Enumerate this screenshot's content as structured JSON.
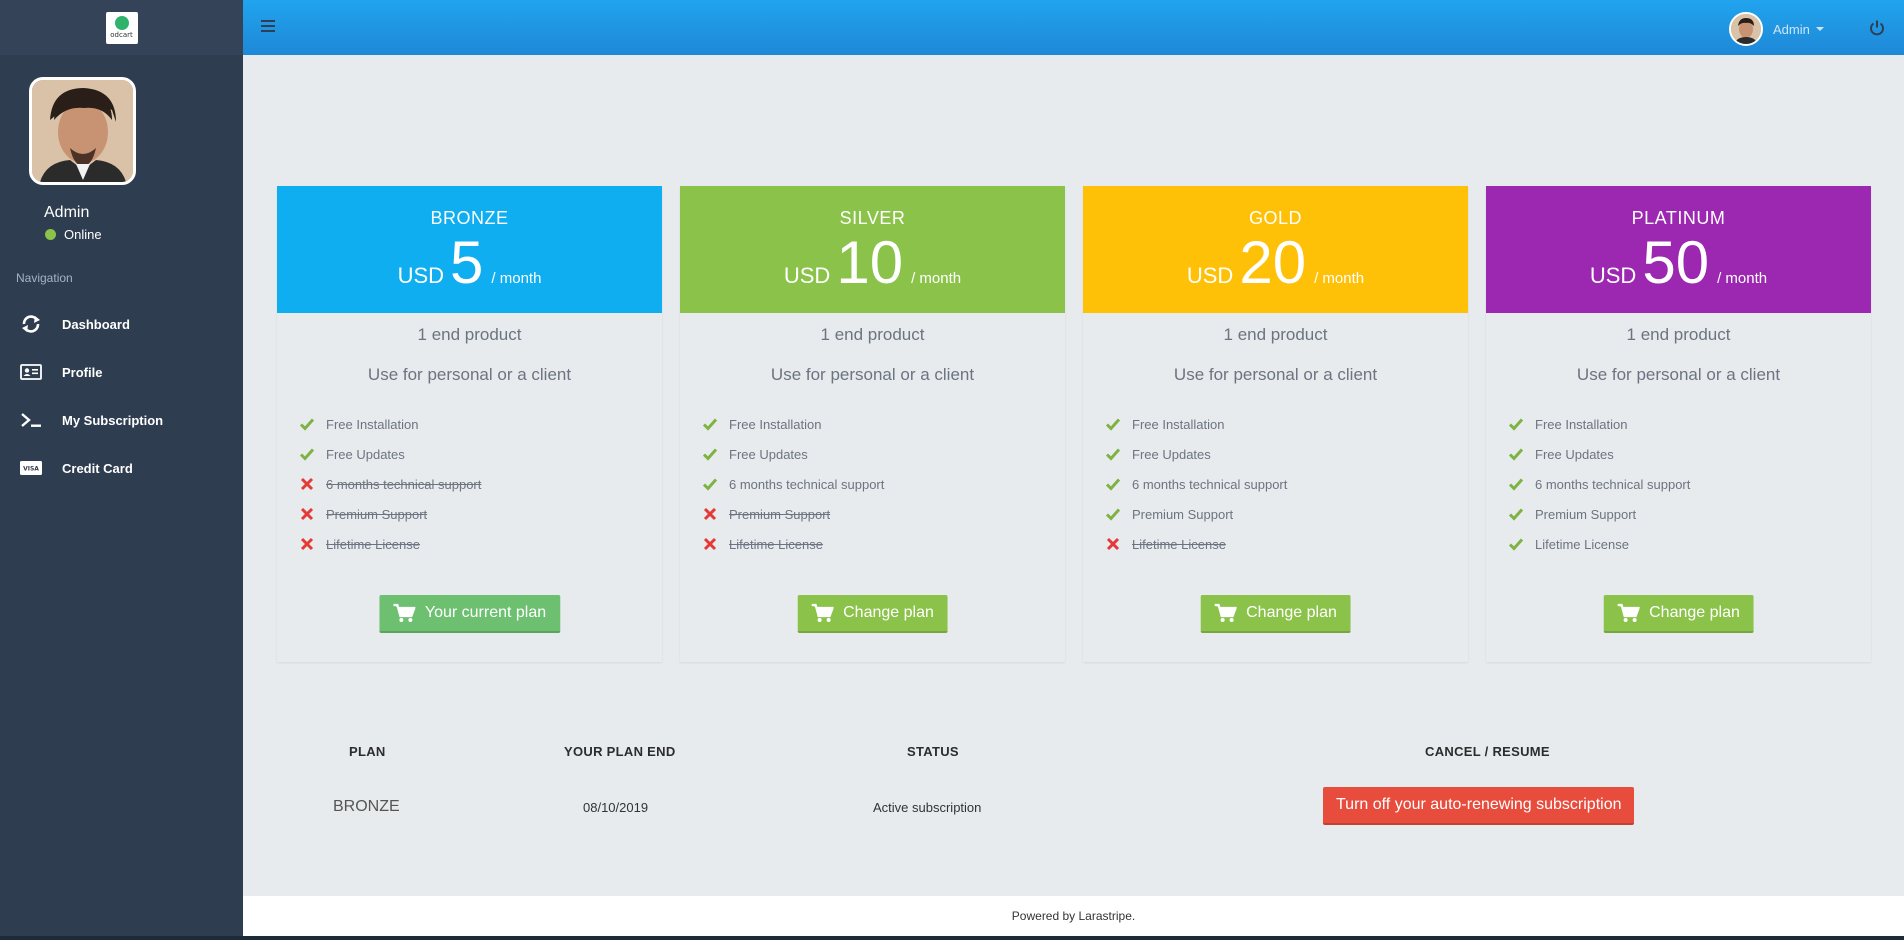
{
  "sidebar": {
    "logo_text": "odcart",
    "user_name": "Admin",
    "status": "Online",
    "nav_header": "Navigation",
    "items": [
      {
        "label": "Dashboard",
        "icon": "refresh-icon"
      },
      {
        "label": "Profile",
        "icon": "id-card-icon"
      },
      {
        "label": "My Subscription",
        "icon": "terminal-icon"
      },
      {
        "label": "Credit Card",
        "icon": "visa-card-icon"
      }
    ]
  },
  "topbar": {
    "user_name": "Admin"
  },
  "plans": [
    {
      "name": "BRONZE",
      "currency": "USD",
      "amount": "5",
      "period": "/ month",
      "color": "#0eaef0",
      "sub1": "1 end product",
      "sub2": "Use for personal or a client",
      "features": [
        {
          "text": "Free Installation",
          "included": true
        },
        {
          "text": "Free Updates",
          "included": true
        },
        {
          "text": "6 months technical support",
          "included": false
        },
        {
          "text": "Premium Support",
          "included": false
        },
        {
          "text": "Lifetime License",
          "included": false
        }
      ],
      "button": "Your current plan",
      "button_color": "#6cc070"
    },
    {
      "name": "SILVER",
      "currency": "USD",
      "amount": "10",
      "period": "/ month",
      "color": "#8bc34a",
      "sub1": "1 end product",
      "sub2": "Use for personal or a client",
      "features": [
        {
          "text": "Free Installation",
          "included": true
        },
        {
          "text": "Free Updates",
          "included": true
        },
        {
          "text": "6 months technical support",
          "included": true
        },
        {
          "text": "Premium Support",
          "included": false
        },
        {
          "text": "Lifetime License",
          "included": false
        }
      ],
      "button": "Change plan",
      "button_color": "#8bc34a"
    },
    {
      "name": "GOLD",
      "currency": "USD",
      "amount": "20",
      "period": "/ month",
      "color": "#ffc107",
      "sub1": "1 end product",
      "sub2": "Use for personal or a client",
      "features": [
        {
          "text": "Free Installation",
          "included": true
        },
        {
          "text": "Free Updates",
          "included": true
        },
        {
          "text": "6 months technical support",
          "included": true
        },
        {
          "text": "Premium Support",
          "included": true
        },
        {
          "text": "Lifetime License",
          "included": false
        }
      ],
      "button": "Change plan",
      "button_color": "#8bc34a"
    },
    {
      "name": "PLATINUM",
      "currency": "USD",
      "amount": "50",
      "period": "/ month",
      "color": "#9c27b0",
      "sub1": "1 end product",
      "sub2": "Use for personal or a client",
      "features": [
        {
          "text": "Free Installation",
          "included": true
        },
        {
          "text": "Free Updates",
          "included": true
        },
        {
          "text": "6 months technical support",
          "included": true
        },
        {
          "text": "Premium Support",
          "included": true
        },
        {
          "text": "Lifetime License",
          "included": true
        }
      ],
      "button": "Change plan",
      "button_color": "#8bc34a"
    }
  ],
  "subscription": {
    "headers": {
      "plan": "PLAN",
      "end": "YOUR PLAN END",
      "status": "STATUS",
      "cancel": "CANCEL / RESUME"
    },
    "row": {
      "plan": "BRONZE",
      "end": "08/10/2019",
      "status": "Active subscription",
      "action": "Turn off your auto-renewing subscription"
    }
  },
  "footer": {
    "text": "Powered by Larastripe."
  },
  "colors": {
    "sidebar": "#2e3d50",
    "topbar": "#1e97e3",
    "check": "#7cb342",
    "cross": "#e53935",
    "danger": "#e74c3c"
  }
}
